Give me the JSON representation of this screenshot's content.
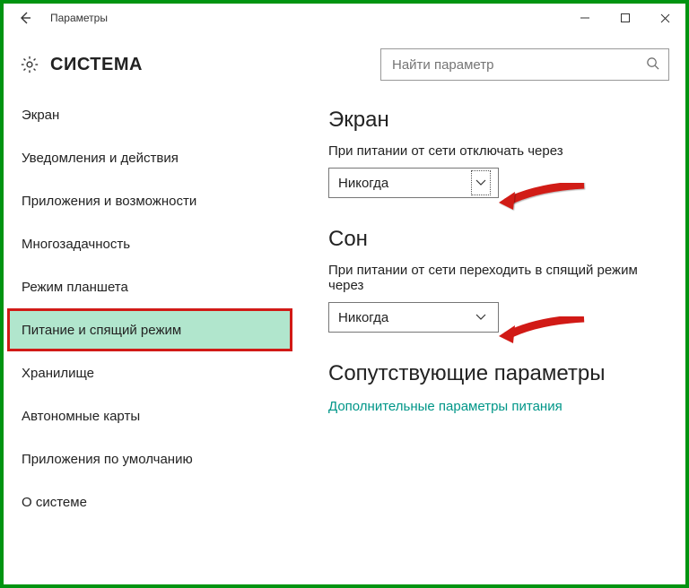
{
  "window": {
    "title": "Параметры"
  },
  "header": {
    "title": "СИСТЕМА",
    "search_placeholder": "Найти параметр"
  },
  "sidebar": {
    "items": [
      {
        "label": "Экран",
        "selected": false
      },
      {
        "label": "Уведомления и действия",
        "selected": false
      },
      {
        "label": "Приложения и возможности",
        "selected": false
      },
      {
        "label": "Многозадачность",
        "selected": false
      },
      {
        "label": "Режим планшета",
        "selected": false
      },
      {
        "label": "Питание и спящий режим",
        "selected": true
      },
      {
        "label": "Хранилище",
        "selected": false
      },
      {
        "label": "Автономные карты",
        "selected": false
      },
      {
        "label": "Приложения по умолчанию",
        "selected": false
      },
      {
        "label": "О системе",
        "selected": false
      }
    ]
  },
  "main": {
    "section_screen": {
      "title": "Экран",
      "label": "При питании от сети отключать через",
      "dropdown_value": "Никогда"
    },
    "section_sleep": {
      "title": "Сон",
      "label": "При питании от сети переходить в спящий режим через",
      "dropdown_value": "Никогда"
    },
    "section_related": {
      "title": "Сопутствующие параметры",
      "link": "Дополнительные параметры питания"
    }
  }
}
